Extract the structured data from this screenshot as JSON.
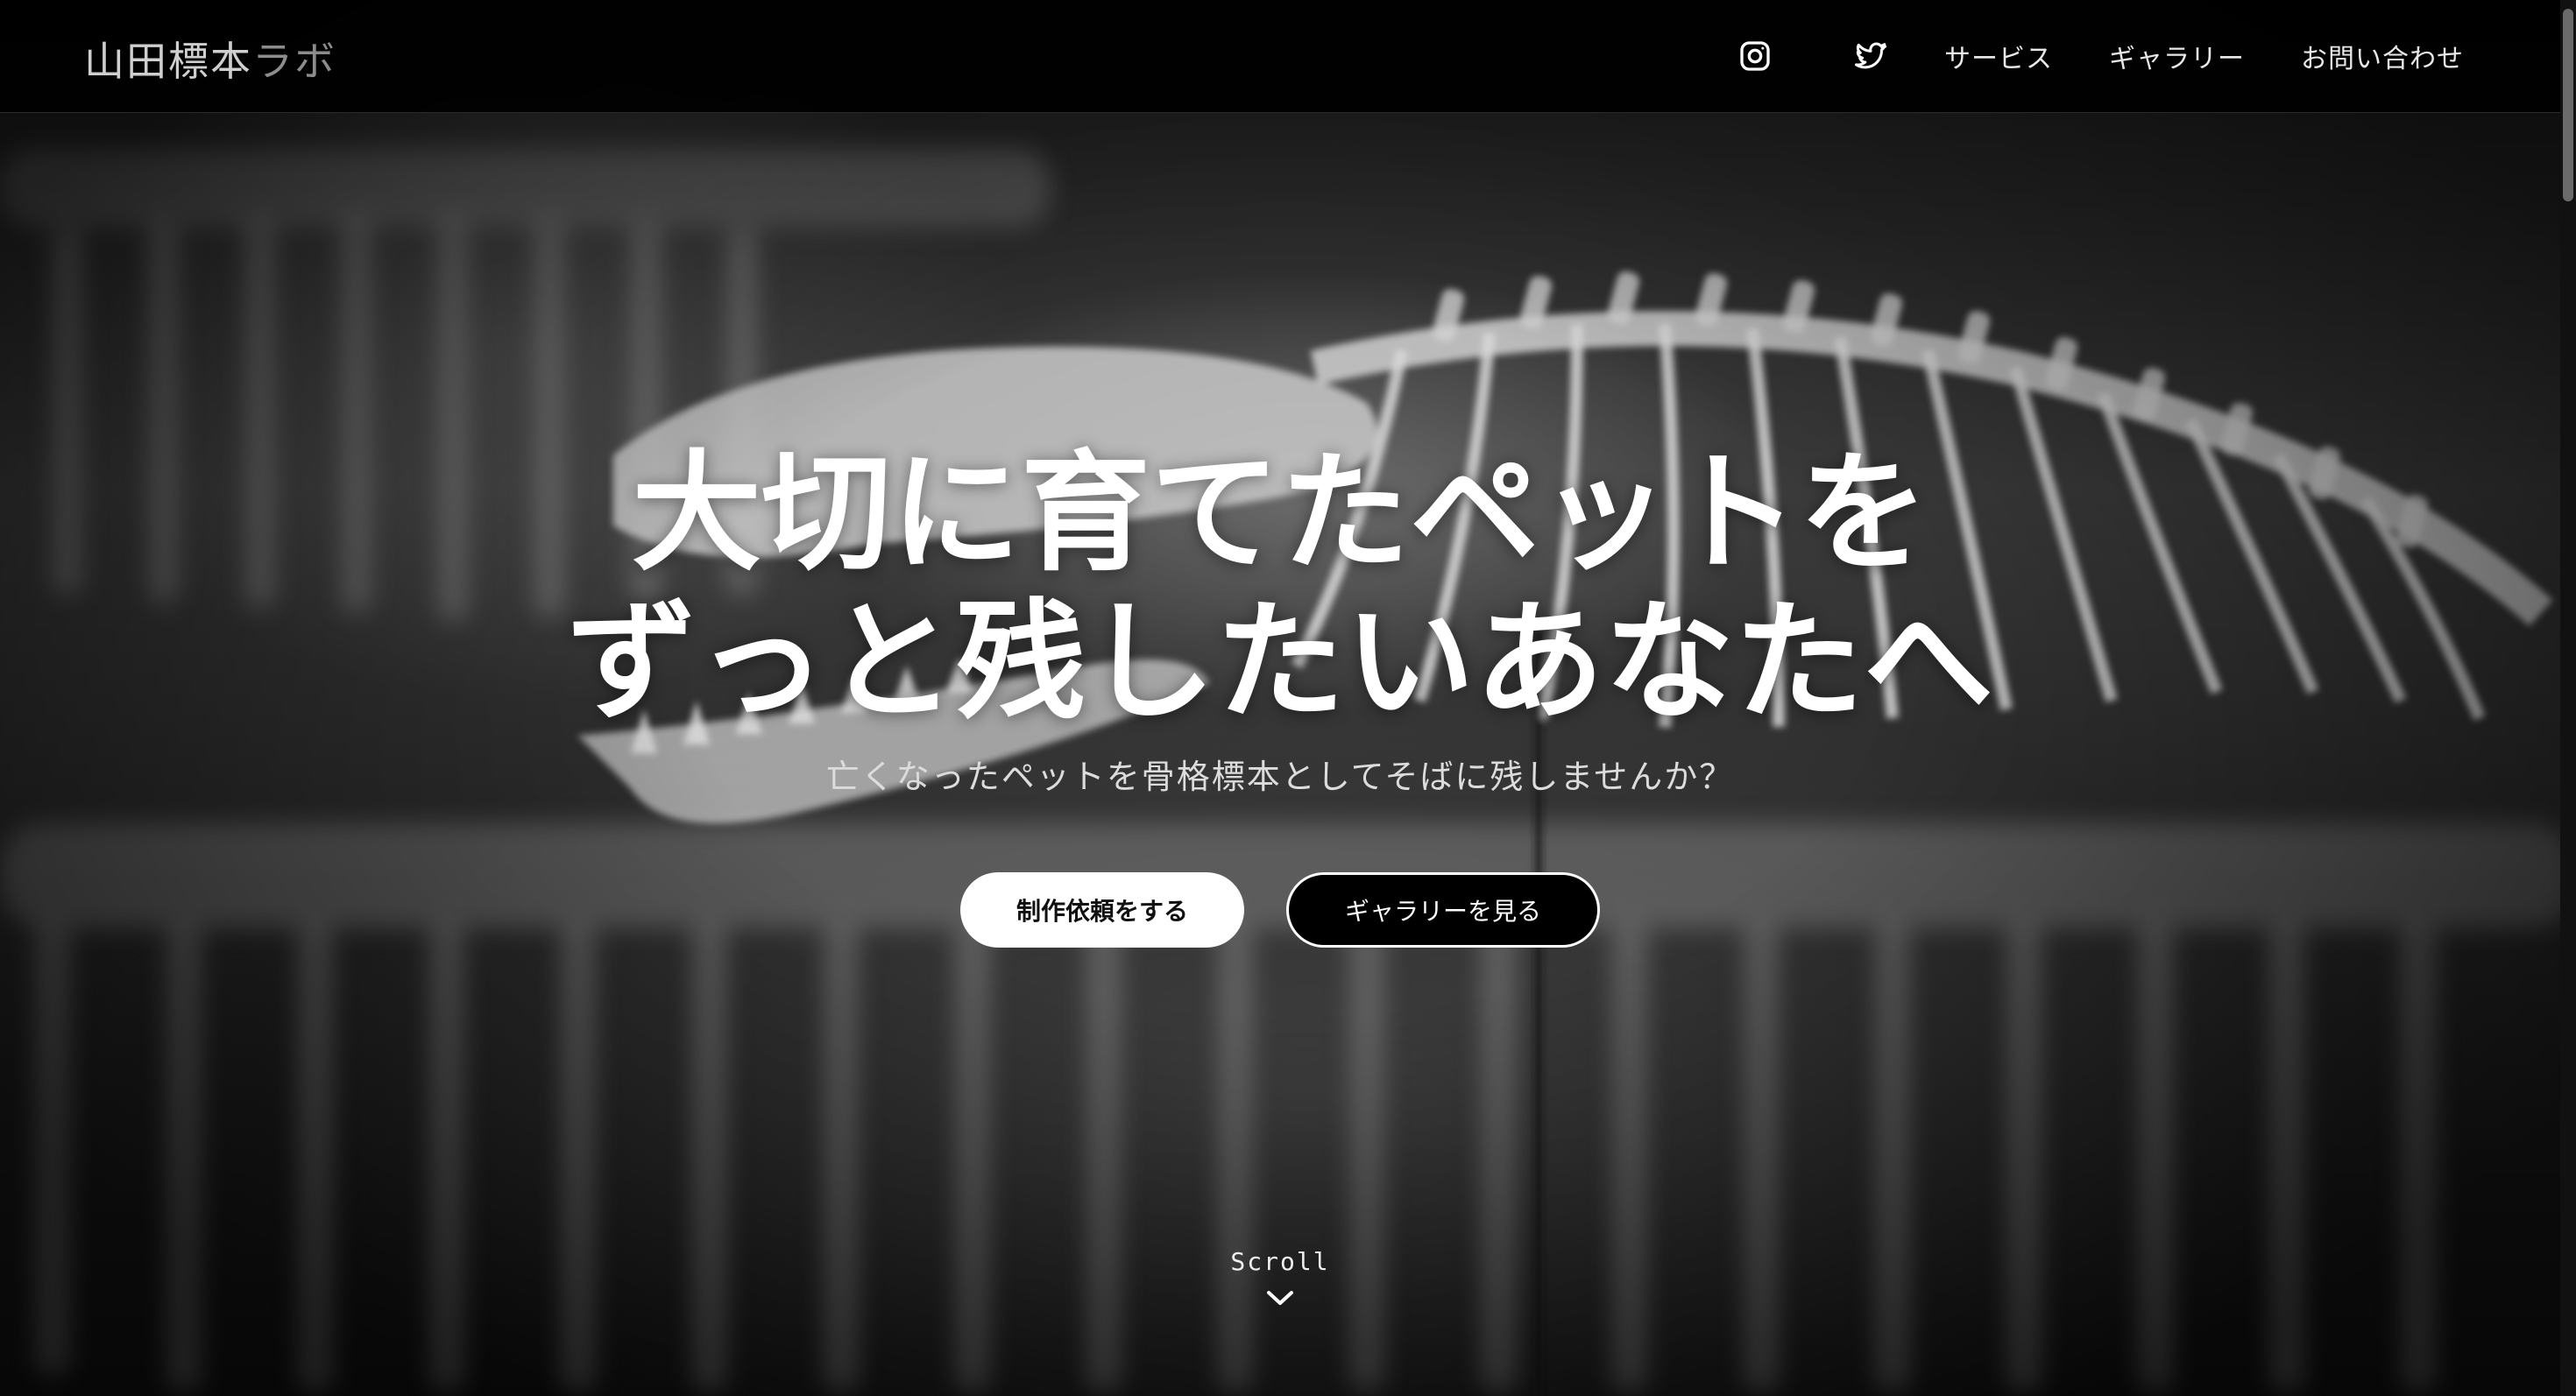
{
  "header": {
    "logo_main": "山田標本",
    "logo_tail": "ラボ",
    "nav": {
      "instagram_icon": "instagram-icon",
      "twitter_icon": "twitter-icon",
      "links": [
        {
          "label": "サービス"
        },
        {
          "label": "ギャラリー"
        },
        {
          "label": "お問い合わせ"
        }
      ]
    }
  },
  "hero": {
    "title_line1": "大切に育てたペットを",
    "title_line2": "ずっと残したいあなたへ",
    "subtitle": "亡くなったペットを骨格標本としてそばに残しませんか？",
    "primary_button": "制作依頼をする",
    "secondary_button": "ギャラリーを見る",
    "scroll_label": "Scroll",
    "scroll_icon": "chevron-down-icon"
  },
  "colors": {
    "header_bg": "#000000",
    "text": "#ffffff",
    "button_primary_bg": "#ffffff",
    "button_secondary_bg": "#000000"
  }
}
